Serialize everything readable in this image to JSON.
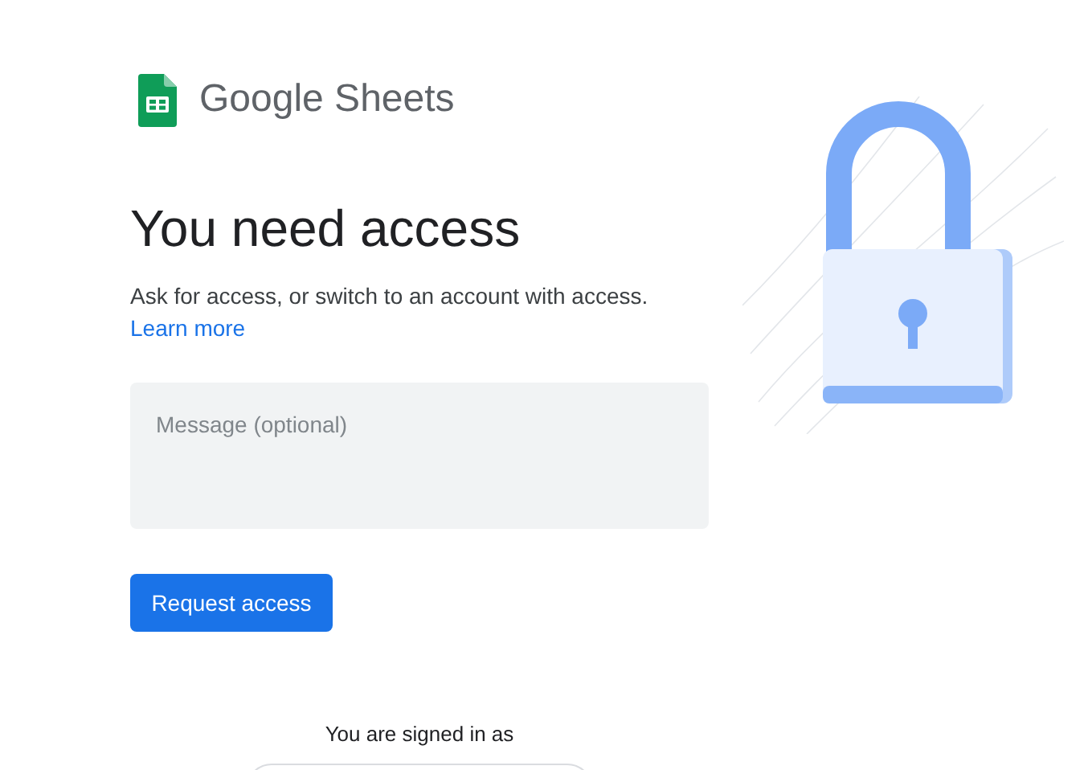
{
  "brand": {
    "name": "Google Sheets"
  },
  "heading": "You need access",
  "description": "Ask for access, or switch to an account with access.",
  "learn_more_link": "Learn more",
  "message_field": {
    "placeholder": "Message (optional)"
  },
  "request_button": "Request access",
  "signed_in_label": "You are signed in as"
}
